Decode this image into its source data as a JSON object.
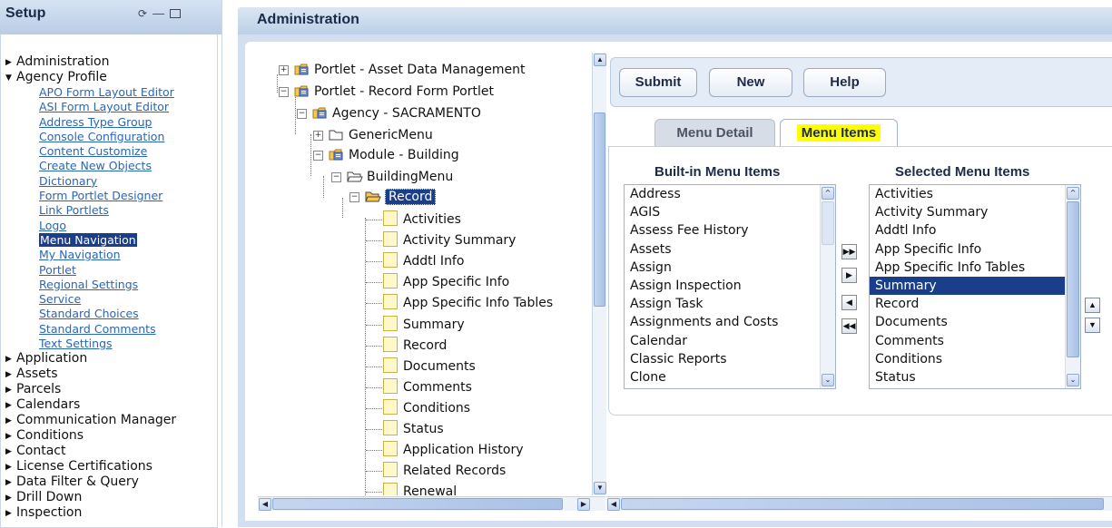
{
  "setup": {
    "title": "Setup",
    "icons": [
      "refresh-icon",
      "minimize-icon",
      "maximize-icon"
    ],
    "nav": [
      {
        "label": "Administration",
        "expanded": false
      },
      {
        "label": "Agency Profile",
        "expanded": true,
        "children": [
          "APO Form Layout Editor",
          "ASI Form Layout Editor",
          "Address Type Group",
          "Console Configuration",
          "Content Customize",
          "Create New Objects",
          "Dictionary",
          "Form Portlet Designer",
          "Link Portlets",
          "Logo",
          "Menu Navigation",
          "My Navigation",
          "Portlet",
          "Regional Settings",
          "Service",
          "Standard Choices",
          "Standard Comments",
          "Text Settings"
        ],
        "selected": "Menu Navigation"
      },
      {
        "label": "Application"
      },
      {
        "label": "Assets"
      },
      {
        "label": "Parcels"
      },
      {
        "label": "Calendars"
      },
      {
        "label": "Communication Manager"
      },
      {
        "label": "Conditions"
      },
      {
        "label": "Contact"
      },
      {
        "label": "License Certifications"
      },
      {
        "label": "Data Filter & Query"
      },
      {
        "label": "Drill Down"
      },
      {
        "label": "Inspection"
      }
    ]
  },
  "admin": {
    "title": "Administration",
    "tree": {
      "nodes": [
        "Portlet - Asset Data Management",
        "Portlet - Record Form Portlet",
        "Agency - SACRAMENTO",
        "GenericMenu",
        "Module - Building",
        "BuildingMenu",
        "Record"
      ],
      "record_items": [
        "Activities",
        "Activity Summary",
        "Addtl Info",
        "App Specific Info",
        "App Specific Info Tables",
        "Summary",
        "Record",
        "Documents",
        "Comments",
        "Conditions",
        "Status",
        "Application History",
        "Related Records",
        "Renewal"
      ],
      "selected": "Record"
    },
    "buttons": {
      "submit": "Submit",
      "new": "New",
      "help": "Help"
    },
    "tabs": {
      "detail": "Menu Detail",
      "items": "Menu Items",
      "active": "Menu Items"
    },
    "builtin": {
      "title": "Built-in Menu Items",
      "items": [
        "Address",
        "AGIS",
        "Assess Fee History",
        "Assets",
        "Assign",
        "Assign Inspection",
        "Assign Task",
        "Assignments and Costs",
        "Calendar",
        "Classic Reports",
        "Clone"
      ]
    },
    "selected_list": {
      "title": "Selected Menu Items",
      "items": [
        "Activities",
        "Activity Summary",
        "Addtl Info",
        "App Specific Info",
        "App Specific Info Tables",
        "Summary",
        "Record",
        "Documents",
        "Comments",
        "Conditions",
        "Status"
      ],
      "selected": "Summary"
    },
    "move_buttons": [
      "move-all-right-icon",
      "move-right-icon",
      "move-left-icon",
      "move-all-left-icon"
    ],
    "order_buttons": [
      "move-up-icon",
      "move-down-icon"
    ]
  },
  "colors": {
    "selection": "#1a3e8a",
    "link": "#2a66b8",
    "highlight": "#ffff00",
    "header": "#bcd0e8"
  }
}
